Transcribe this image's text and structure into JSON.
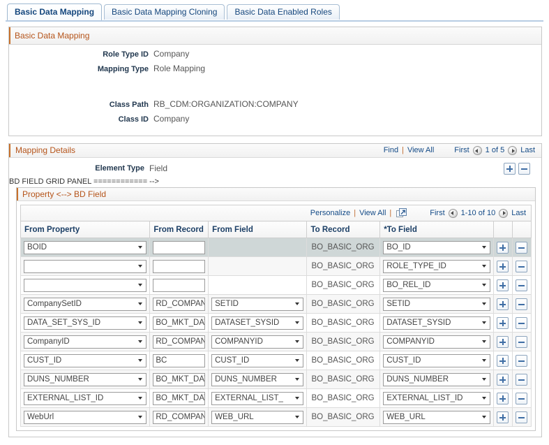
{
  "tabs": [
    {
      "label": "Basic Data Mapping",
      "active": true
    },
    {
      "label": "Basic Data Mapping Cloning",
      "active": false
    },
    {
      "label": "Basic Data Enabled Roles",
      "active": false
    }
  ],
  "basic_data_mapping": {
    "section_title": "Basic Data Mapping",
    "fields": [
      {
        "label": "Role Type ID",
        "value": "Company"
      },
      {
        "label": "Mapping Type",
        "value": "Role Mapping"
      },
      {
        "label": "Class Path",
        "value": "RB_CDM:ORGANIZATION:COMPANY"
      },
      {
        "label": "Class ID",
        "value": "Company"
      }
    ]
  },
  "mapping_details": {
    "section_title": "Mapping Details",
    "find_label": "Find",
    "view_all_label": "View All",
    "first_label": "First",
    "last_label": "Last",
    "page_indicator": "1 of 5",
    "prev_icon": "prev-arrow-icon",
    "next_icon": "next-arrow-icon",
    "add_row_icon": "plus-icon",
    "delete_row_icon": "minus-icon",
    "element_type_label": "Element Type",
    "element_type_value": "Field"
  },
  "property_grid": {
    "section_title": "Property <--> BD Field",
    "toolbar": {
      "personalize_label": "Personalize",
      "view_all_label": "View All",
      "popout_icon": "popout-window-icon",
      "first_label": "First",
      "last_label": "Last",
      "range_indicator": "1-10 of 10",
      "prev_icon": "prev-arrow-icon",
      "next_icon": "next-arrow-icon"
    },
    "columns": [
      "From Property",
      "From Record",
      "From Field",
      "To Record",
      "*To Field"
    ],
    "rows": [
      {
        "from_property": "BOID",
        "from_record": "",
        "from_field": null,
        "to_record": "BO_BASIC_ORG",
        "to_field": "BO_ID"
      },
      {
        "from_property": "",
        "from_record": "",
        "from_field": null,
        "to_record": "BO_BASIC_ORG",
        "to_field": "ROLE_TYPE_ID"
      },
      {
        "from_property": "",
        "from_record": "",
        "from_field": null,
        "to_record": "BO_BASIC_ORG",
        "to_field": "BO_REL_ID"
      },
      {
        "from_property": "CompanySetID",
        "from_record": "RD_COMPANY",
        "from_field": "SETID",
        "to_record": "BO_BASIC_ORG",
        "to_field": "SETID"
      },
      {
        "from_property": "DATA_SET_SYS_ID",
        "from_record": "BO_MKT_DATA",
        "from_field": "DATASET_SYSID",
        "to_record": "BO_BASIC_ORG",
        "to_field": "DATASET_SYSID"
      },
      {
        "from_property": "CompanyID",
        "from_record": "RD_COMPANY",
        "from_field": "COMPANYID",
        "to_record": "BO_BASIC_ORG",
        "to_field": "COMPANYID"
      },
      {
        "from_property": "CUST_ID",
        "from_record": "BC",
        "from_field": "CUST_ID",
        "to_record": "BO_BASIC_ORG",
        "to_field": "CUST_ID"
      },
      {
        "from_property": "DUNS_NUMBER",
        "from_record": "BO_MKT_DATA",
        "from_field": "DUNS_NUMBER",
        "to_record": "BO_BASIC_ORG",
        "to_field": "DUNS_NUMBER"
      },
      {
        "from_property": "EXTERNAL_LIST_ID",
        "from_record": "BO_MKT_DATA",
        "from_field": "EXTERNAL_LIST_",
        "to_record": "BO_BASIC_ORG",
        "to_field": "EXTERNAL_LIST_ID"
      },
      {
        "from_property": "WebUrl",
        "from_record": "RD_COMPANY",
        "from_field": "WEB_URL",
        "to_record": "BO_BASIC_ORG",
        "to_field": "WEB_URL"
      }
    ],
    "row_add_icon": "plus-icon",
    "row_delete_icon": "minus-icon"
  },
  "colors": {
    "section_header_text": "#b5541a",
    "link": "#134a86",
    "column_header_text": "#1c3f66",
    "highlight_row": "#cfd7d7"
  }
}
